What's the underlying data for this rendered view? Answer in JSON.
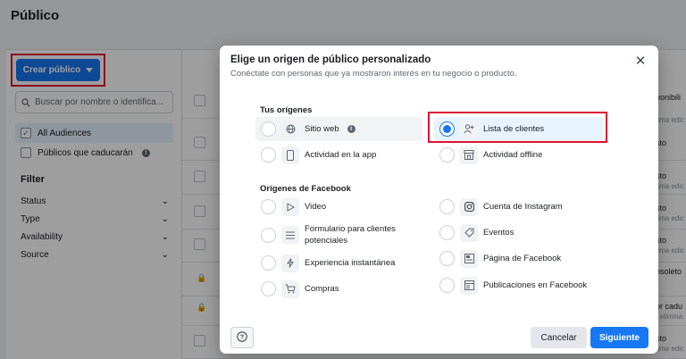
{
  "page": {
    "title": "Público"
  },
  "sidebar": {
    "create_label": "Crear público",
    "search_placeholder": "Buscar por nombre o identifica...",
    "audience_filters": [
      {
        "label": "All Audiences",
        "checked": true
      },
      {
        "label": "Públicos que caducarán",
        "checked": false
      }
    ],
    "filter_title": "Filter",
    "filters": [
      "Status",
      "Type",
      "Availability",
      "Source"
    ]
  },
  "table": {
    "right_col": [
      {
        "text": "oonibili",
        "sub": ""
      },
      {
        "text": "",
        "sub": "tima edic"
      },
      {
        "text": "sto",
        "sub": ""
      },
      {
        "text": "sto",
        "sub": "tima edic"
      },
      {
        "text": "sto",
        "sub": "tima edic"
      },
      {
        "text": "sto",
        "sub": "tima edic"
      },
      {
        "text": "sto",
        "sub": "tima edic"
      },
      {
        "text": "osoleto",
        "sub": ""
      },
      {
        "text": "or cadu",
        "sub": "r elimina"
      },
      {
        "text": "sto",
        "sub": "tima edic"
      }
    ]
  },
  "modal": {
    "title": "Elige un origen de público personalizado",
    "subtitle": "Conéctate con personas que ya mostraron interés en tu negocio o producto.",
    "close_icon": "close-icon",
    "sections": {
      "own": "Tus orígenes",
      "facebook": "Orígenes de Facebook"
    },
    "own_options": [
      {
        "label": "Sitio web",
        "icon": "globe-icon",
        "selected": false
      },
      {
        "label": "Lista de clientes",
        "icon": "customer-list-icon",
        "selected": true
      },
      {
        "label": "Actividad en la app",
        "icon": "mobile-app-icon",
        "selected": false
      },
      {
        "label": "Actividad offline",
        "icon": "store-icon",
        "selected": false
      }
    ],
    "fb_options": [
      {
        "label": "Video",
        "icon": "play-icon"
      },
      {
        "label": "Cuenta de Instagram",
        "icon": "instagram-icon"
      },
      {
        "label": "Formulario para clientes potenciales",
        "icon": "form-icon"
      },
      {
        "label": "Eventos",
        "icon": "tag-icon"
      },
      {
        "label": "Experiencia instantánea",
        "icon": "lightning-icon"
      },
      {
        "label": "Página de Facebook",
        "icon": "page-icon"
      },
      {
        "label": "Compras",
        "icon": "cart-icon"
      },
      {
        "label": "Publicaciones en Facebook",
        "icon": "posts-icon"
      }
    ],
    "help_icon": "help-icon",
    "cancel_label": "Cancelar",
    "next_label": "Siguiente"
  }
}
